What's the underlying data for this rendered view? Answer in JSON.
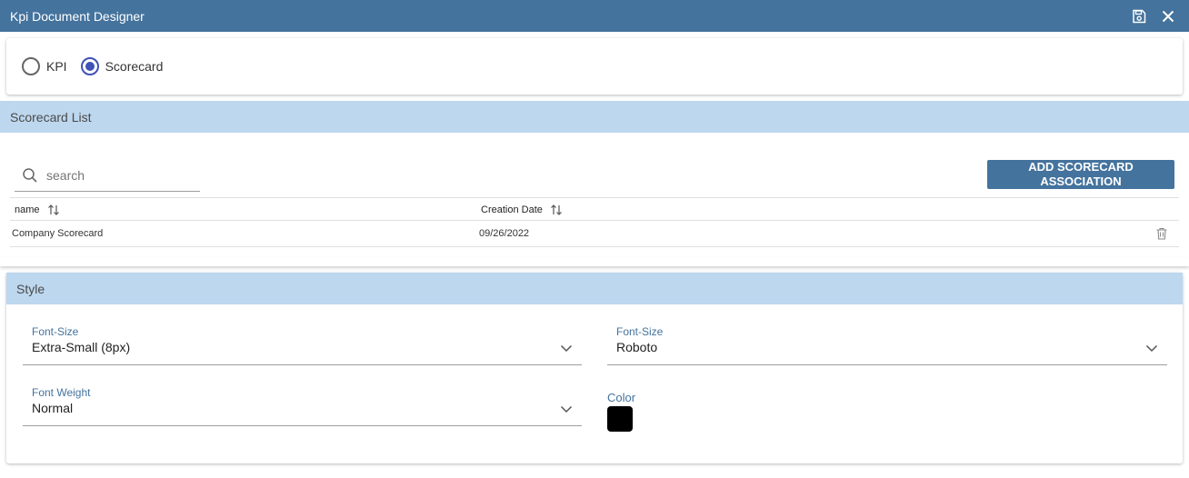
{
  "window": {
    "title": "Kpi Document Designer"
  },
  "mode": {
    "options": [
      {
        "label": "KPI",
        "selected": false
      },
      {
        "label": "Scorecard",
        "selected": true
      }
    ]
  },
  "scorecard_list": {
    "title": "Scorecard List",
    "search": {
      "placeholder": "search",
      "value": ""
    },
    "add_button": "ADD SCORECARD ASSOCIATION",
    "columns": [
      "name",
      "Creation Date"
    ],
    "rows": [
      {
        "name": "Company Scorecard",
        "date": "09/26/2022"
      }
    ]
  },
  "style": {
    "title": "Style",
    "font_size": {
      "label": "Font-Size",
      "value": "Extra-Small (8px)"
    },
    "font_family": {
      "label": "Font-Size",
      "value": "Roboto"
    },
    "font_weight": {
      "label": "Font Weight",
      "value": "Normal"
    },
    "color": {
      "label": "Color",
      "value": "#000000"
    }
  },
  "colors": {
    "header": "#44739d",
    "section": "#bdd7ee",
    "accent": "#3f51b5"
  }
}
